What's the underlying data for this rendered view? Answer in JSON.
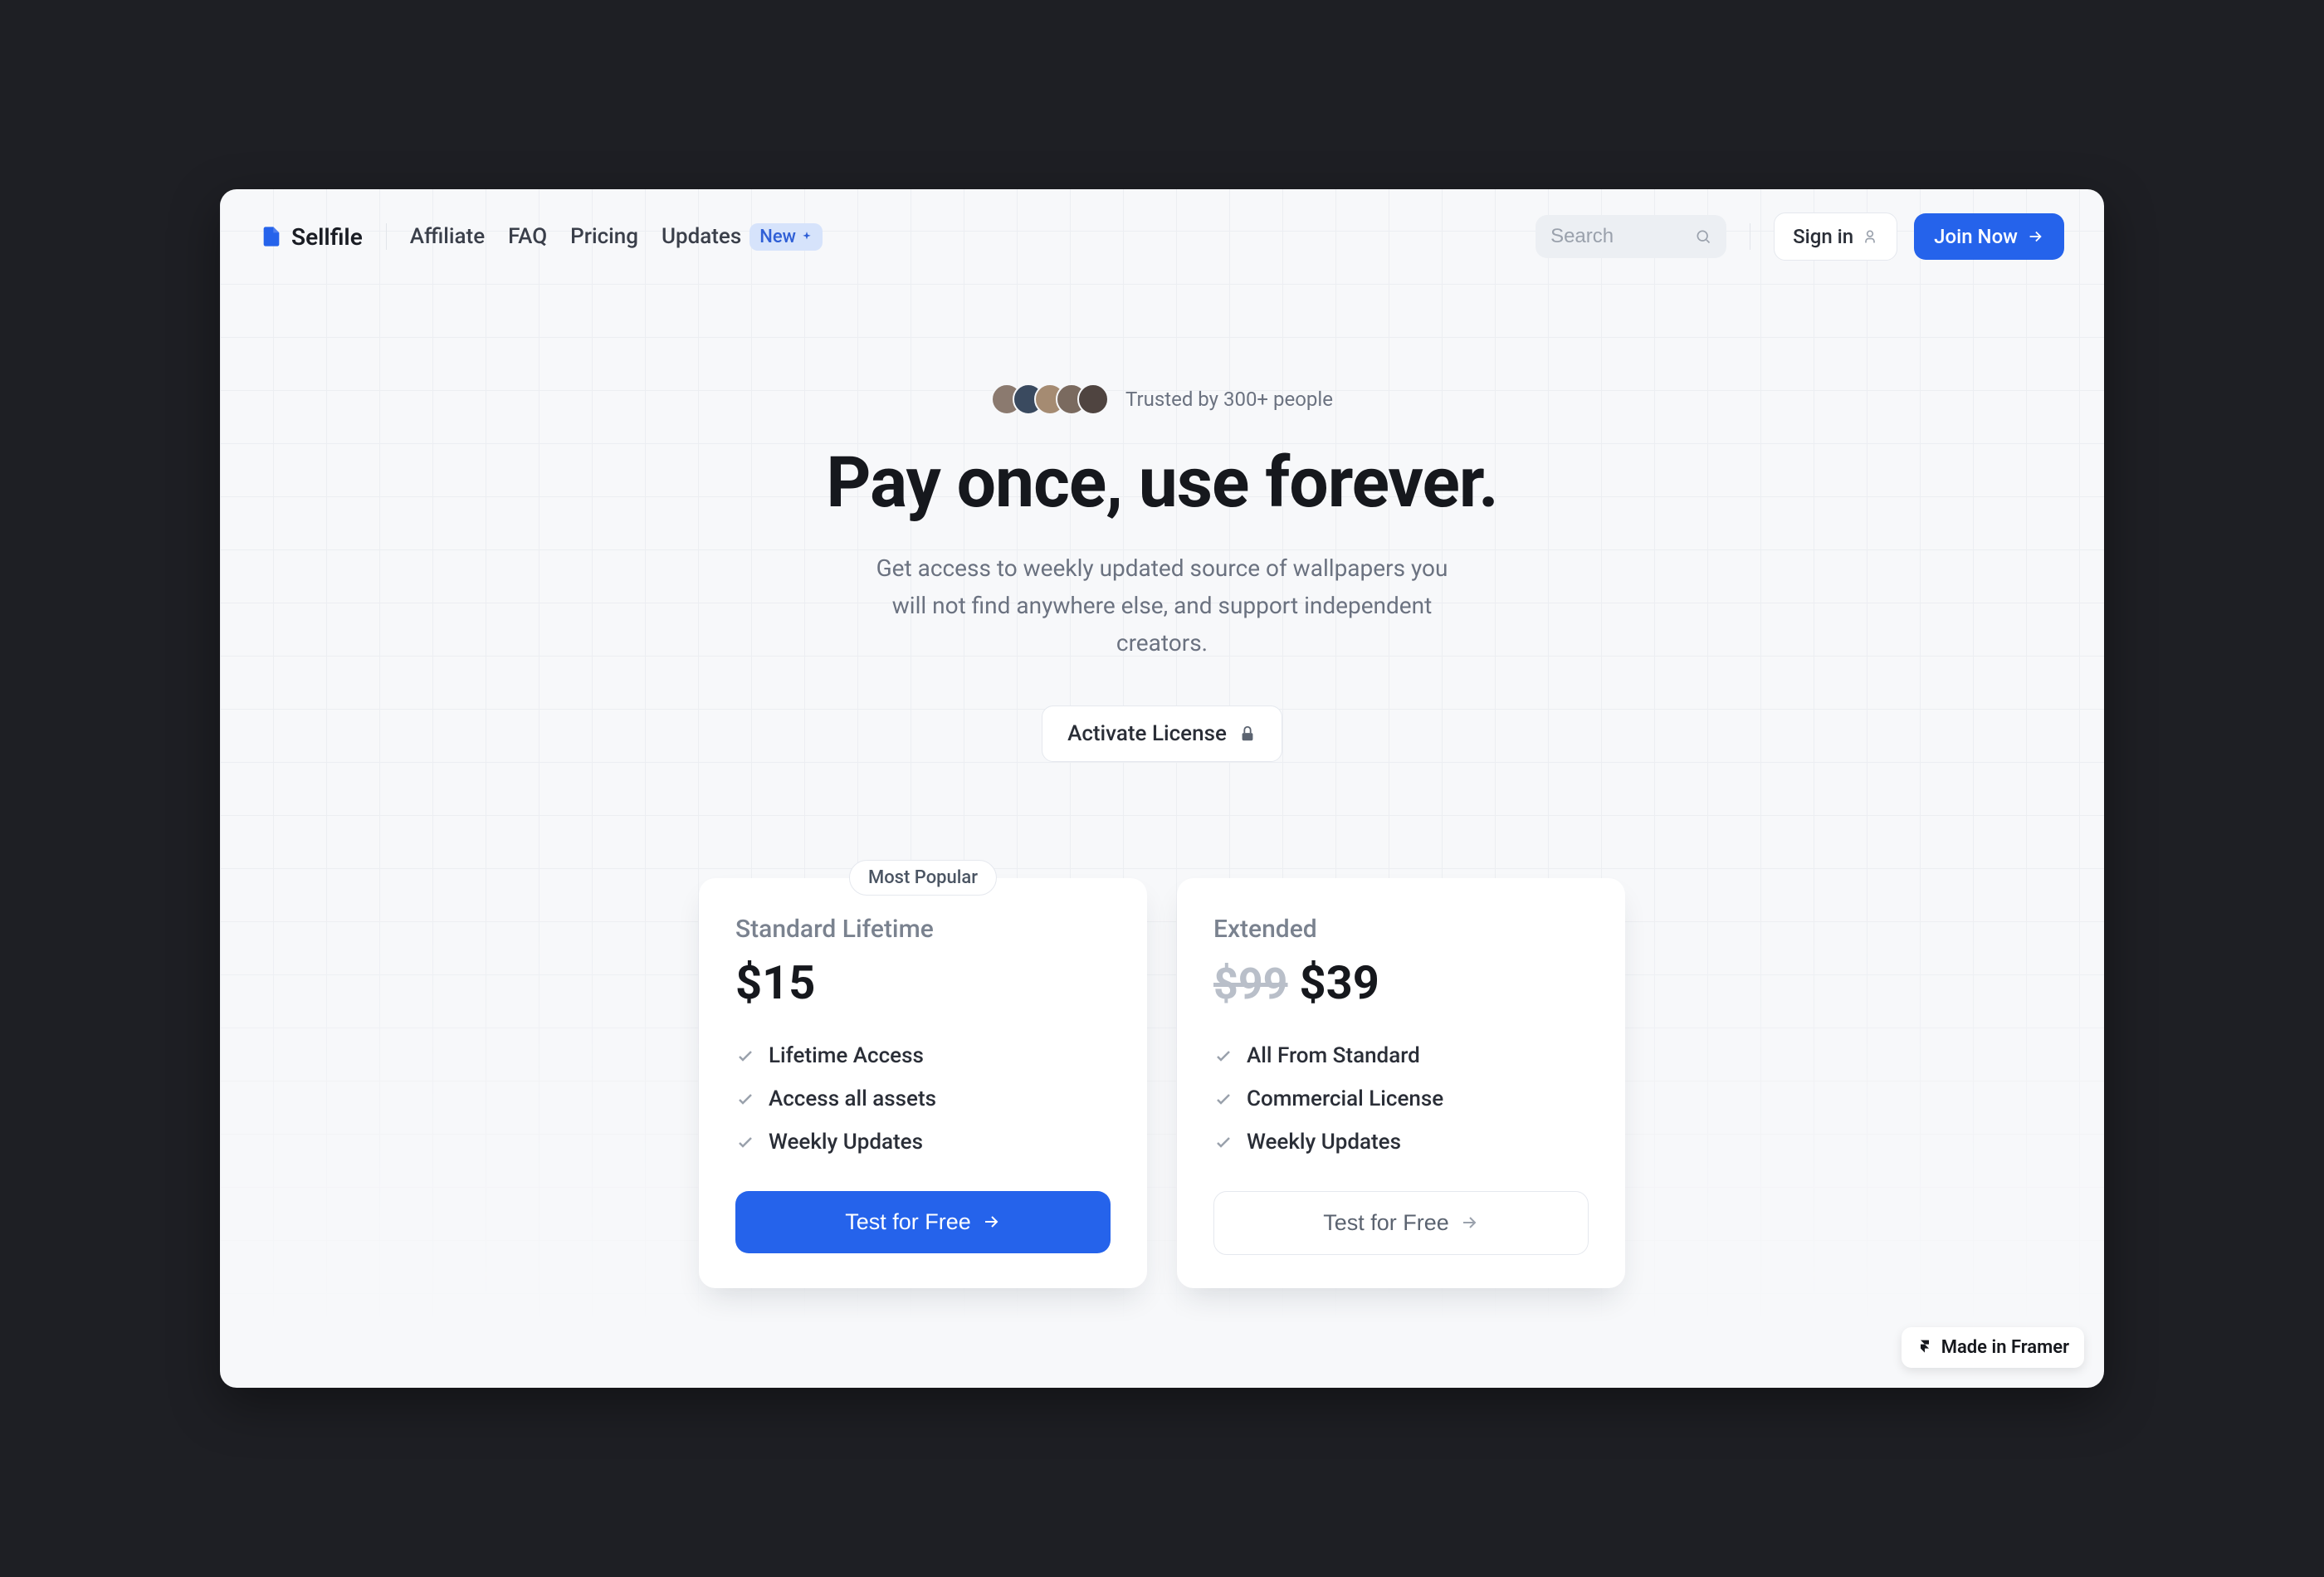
{
  "brand": "Sellfile",
  "nav": {
    "links": [
      "Affiliate",
      "FAQ",
      "Pricing",
      "Updates"
    ],
    "new_badge": "New"
  },
  "search": {
    "placeholder": "Search"
  },
  "auth": {
    "signin": "Sign in",
    "join": "Join Now"
  },
  "hero": {
    "trust": "Trusted by 300+ people",
    "title": "Pay once, use forever.",
    "subtitle": "Get access to weekly updated source of wallpapers you will not find anywhere else, and support independent creators.",
    "activate": "Activate License"
  },
  "plans": [
    {
      "title": "Standard Lifetime",
      "price": "$15",
      "old_price": "",
      "popular": "Most Popular",
      "features": [
        "Lifetime Access",
        "Access all assets",
        "Weekly Updates"
      ],
      "cta": "Test for Free"
    },
    {
      "title": "Extended",
      "price": "$39",
      "old_price": "$99",
      "popular": "",
      "features": [
        "All From Standard",
        "Commercial License",
        "Weekly Updates"
      ],
      "cta": "Test for Free"
    }
  ],
  "framer": "Made in Framer",
  "avatar_colors": [
    "#8b7a6f",
    "#3a4a5f",
    "#a58b72",
    "#7a6a5f",
    "#4f4440"
  ]
}
